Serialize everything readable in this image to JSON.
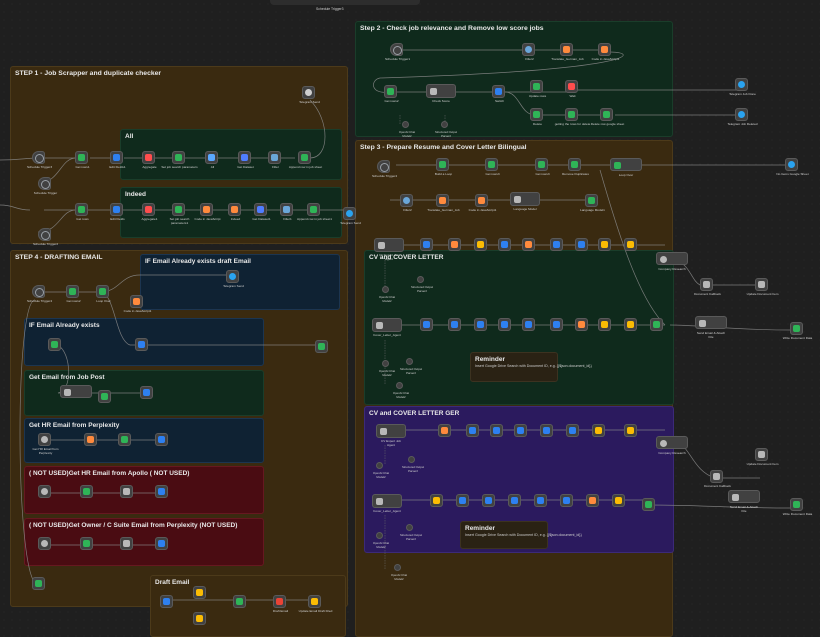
{
  "canvas": {
    "top_label": "Schedule Trigger3",
    "colors": {
      "bg": "#1f1f1f",
      "node": "#414141",
      "node_border": "#5a5a5a",
      "wire": "#8a8a8a",
      "accent_green": "#2fb457",
      "accent_blue": "#2e80f0",
      "accent_red": "#ff4d4d",
      "accent_orange": "#ff8a3d",
      "accent_purple": "#7a5cff"
    }
  },
  "stickies": [
    {
      "id": "step1",
      "title": "STEP 1 - Job Scrapper and duplicate checker",
      "color": "brown"
    },
    {
      "id": "all",
      "title": "All",
      "color": "green"
    },
    {
      "id": "indeed",
      "title": "Indeed",
      "color": "green"
    },
    {
      "id": "step2",
      "title": "Step 2 - Check job relevance and Remove low score jobs",
      "color": "green"
    },
    {
      "id": "step3",
      "title": "Step 3 - Prepare Resume and Cover Letter Bilingual",
      "color": "brown"
    },
    {
      "id": "cvlower",
      "title": "CV and COVER LETTER",
      "color": "green"
    },
    {
      "id": "reminder1",
      "title": "Reminder",
      "sub": "Insert Google Drive Search with Document ID, e.g. {{$json.document_id}}",
      "color": "dark"
    },
    {
      "id": "cvger",
      "title": "CV and COVER LETTER GER",
      "color": "purple"
    },
    {
      "id": "reminder2",
      "title": "Reminder",
      "sub": "Insert Google Drive Search with Document ID, e.g. {{$json.document_id}}",
      "color": "dark"
    },
    {
      "id": "step4",
      "title": "STEP 4 - DRAFTING EMAIL",
      "color": "brown"
    },
    {
      "id": "ifdraft",
      "title": "IF Email Already exists draft Email",
      "color": "blue"
    },
    {
      "id": "ifemail",
      "title": "IF Email Already exists",
      "color": "blue"
    },
    {
      "id": "getjob",
      "title": "Get Email from Job Post",
      "color": "green"
    },
    {
      "id": "gethr",
      "title": "Get HR Email from Perplexity",
      "color": "blue"
    },
    {
      "id": "notused1",
      "title": "( NOT USED)Get HR Email from Apollo ( NOT USED)",
      "color": "red"
    },
    {
      "id": "notused2",
      "title": "( NOT USED)Get Owner / C Suite Email from Perplexity (NOT USED)",
      "color": "red"
    },
    {
      "id": "draftemail",
      "title": "Draft Email",
      "color": "brown"
    }
  ],
  "nodes": [
    {
      "name": "Schedule Trigger3",
      "icon": "clock-icon",
      "kind": "trigger",
      "color": "#9aa0a6",
      "sub": ""
    },
    {
      "name": "Schedule Trigger",
      "icon": "clock-icon",
      "kind": "trigger",
      "color": "#9aa0a6",
      "sub": ""
    },
    {
      "name": "Get rows1",
      "icon": "sheet-icon",
      "color": "#2fb457",
      "sub": "read: sheet"
    },
    {
      "name": "Edit Fields1",
      "icon": "pencil-icon",
      "color": "#2e80f0",
      "sub": "manual"
    },
    {
      "name": "Aggregate",
      "icon": "aggregate-icon",
      "color": "#ff4d4d",
      "sub": ""
    },
    {
      "name": "Set job search parameters",
      "icon": "sheet-icon",
      "color": "#2fb457",
      "sub": "read: sheet"
    },
    {
      "name": "All",
      "icon": "apify-icon",
      "color": "#5aa8ff",
      "sub": "Run actor (Apify)"
    },
    {
      "name": "Get Dataset",
      "icon": "apify-icon",
      "color": "#4f7dff",
      "sub": "Get dataset items"
    },
    {
      "name": "Filter",
      "icon": "filter-icon",
      "color": "#6aa6d8",
      "sub": ""
    },
    {
      "name": "Append row in job sheet",
      "icon": "sheet-icon",
      "color": "#2fb457",
      "sub": "append: sheet"
    },
    {
      "name": "Schedule Trigger2",
      "icon": "clock-icon",
      "kind": "trigger",
      "color": "#9aa0a6",
      "sub": ""
    },
    {
      "name": "Get rows",
      "icon": "sheet-icon",
      "color": "#2fb457",
      "sub": "read: sheet"
    },
    {
      "name": "Edit Fields",
      "icon": "pencil-icon",
      "color": "#2e80f0",
      "sub": "manual"
    },
    {
      "name": "Aggregate1",
      "icon": "aggregate-icon",
      "color": "#ff4d4d",
      "sub": ""
    },
    {
      "name": "Set job search parameters1",
      "icon": "sheet-icon",
      "color": "#2fb457",
      "sub": ""
    },
    {
      "name": "Code in JavaScript",
      "icon": "code-icon",
      "color": "#ff8a3d",
      "sub": ""
    },
    {
      "name": "Indeed",
      "icon": "apify-icon",
      "color": "#ff8a3d",
      "sub": "Run actor (Apify)"
    },
    {
      "name": "Get Dataset1",
      "icon": "apify-icon",
      "color": "#4f7dff",
      "sub": ""
    },
    {
      "name": "Filter1",
      "icon": "filter-icon",
      "color": "#6aa6d8",
      "sub": ""
    },
    {
      "name": "Append row in job sheet1",
      "icon": "sheet-icon",
      "color": "#2fb457",
      "sub": ""
    },
    {
      "name": "Telegram Send",
      "icon": "send-icon",
      "color": "#2aa3ef",
      "sub": ""
    },
    {
      "name": "Schedule Trigger1",
      "icon": "clock-icon",
      "kind": "trigger",
      "color": "#9aa0a6",
      "sub": ""
    },
    {
      "name": "Filter2",
      "icon": "globe-icon",
      "color": "#6aa6d8",
      "sub": ""
    },
    {
      "name": "Translate_German_Job",
      "icon": "code-icon",
      "color": "#ff8a3d",
      "sub": ""
    },
    {
      "name": "Code in JavaScript1",
      "icon": "code-icon",
      "color": "#ff8a3d",
      "sub": ""
    },
    {
      "name": "Get rows2",
      "icon": "sheet-icon",
      "color": "#2fb457",
      "sub": ""
    },
    {
      "name": "Check Score",
      "icon": "agent-icon",
      "kind": "agent",
      "color": "#b8b8b8",
      "sub": ""
    },
    {
      "name": "Switch",
      "icon": "switch-icon",
      "color": "#2e80f0",
      "sub": ""
    },
    {
      "name": "Update rows",
      "icon": "sheet-icon",
      "color": "#2fb457",
      "sub": ""
    },
    {
      "name": "Wait",
      "icon": "hourglass-icon",
      "color": "#ff4d4d",
      "sub": ""
    },
    {
      "name": "Delete",
      "icon": "sheet-icon",
      "color": "#2fb457",
      "sub": ""
    },
    {
      "name": "getting the rows for delete",
      "icon": "sheet-icon",
      "color": "#2fb457",
      "sub": ""
    },
    {
      "name": "Delete row google sheet",
      "icon": "sheet-icon",
      "color": "#2fb457",
      "sub": ""
    },
    {
      "name": "Telegram Job Done",
      "icon": "send-icon",
      "color": "#2aa3ef",
      "sub": ""
    },
    {
      "name": "Telegram Job Deleted",
      "icon": "send-icon",
      "color": "#2aa3ef",
      "sub": ""
    },
    {
      "name": "OpenAI Chat Model2",
      "icon": "openai-icon",
      "kind": "sub",
      "color": "#cfcfcf",
      "sub": ""
    },
    {
      "name": "Structured Output Parser2",
      "icon": "parser-icon",
      "kind": "sub",
      "color": "#cfcfcf",
      "sub": ""
    },
    {
      "name": "Schedule Trigger4",
      "icon": "clock-icon",
      "kind": "trigger",
      "color": "#9aa0a6",
      "sub": ""
    },
    {
      "name": "Build a Loop",
      "icon": "sheet-icon",
      "color": "#2fb457",
      "sub": ""
    },
    {
      "name": "Get rows3",
      "icon": "sheet-icon",
      "color": "#2fb457",
      "sub": ""
    },
    {
      "name": "Remove Duplicates",
      "icon": "dup-icon",
      "color": "#2fb457",
      "sub": ""
    },
    {
      "name": "Loop Over",
      "icon": "loop-icon",
      "color": "#2fb457",
      "sub": ""
    },
    {
      "name": "No Items Google Sheet",
      "icon": "send-icon",
      "color": "#2aa3ef",
      "sub": ""
    },
    {
      "name": "Language Model",
      "icon": "agent-icon",
      "kind": "agent",
      "color": "#b8b8b8",
      "sub": ""
    },
    {
      "name": "Language Model1",
      "icon": "code-icon",
      "color": "#2fb457",
      "sub": ""
    },
    {
      "name": "CV Expert Job Agent",
      "icon": "agent-icon",
      "kind": "agent",
      "color": "#b8b8b8",
      "sub": ""
    },
    {
      "name": "Cover_Letter_Agent",
      "icon": "agent-icon",
      "kind": "agent",
      "color": "#b8b8b8",
      "sub": ""
    },
    {
      "name": "Company Research",
      "icon": "globe-icon",
      "color": "#b8b8b8",
      "sub": ""
    },
    {
      "name": "Document Callback",
      "icon": "sheet-icon",
      "color": "#b8b8b8",
      "sub": ""
    },
    {
      "name": "Update Document Item",
      "icon": "sheet-icon",
      "color": "#b8b8b8",
      "sub": ""
    },
    {
      "name": "Send Email & Attach File",
      "icon": "send-icon",
      "color": "#b8b8b8",
      "sub": ""
    },
    {
      "name": "Write Document Data",
      "icon": "sheet-icon",
      "color": "#2fb457",
      "sub": ""
    },
    {
      "name": "Get HR Email from Perplexity",
      "icon": "globe-icon",
      "color": "#b8b8b8",
      "sub": ""
    },
    {
      "name": "Draft Email",
      "icon": "gmail-icon",
      "color": "#ea4335",
      "sub": ""
    },
    {
      "name": "Update Email Draft Filed",
      "icon": "drive-icon",
      "color": "#fbbc04",
      "sub": ""
    }
  ],
  "notes": {
    "reminder_text": "Insert Google Drive Search with Document ID, e.g. {{$json.document_id}}"
  }
}
